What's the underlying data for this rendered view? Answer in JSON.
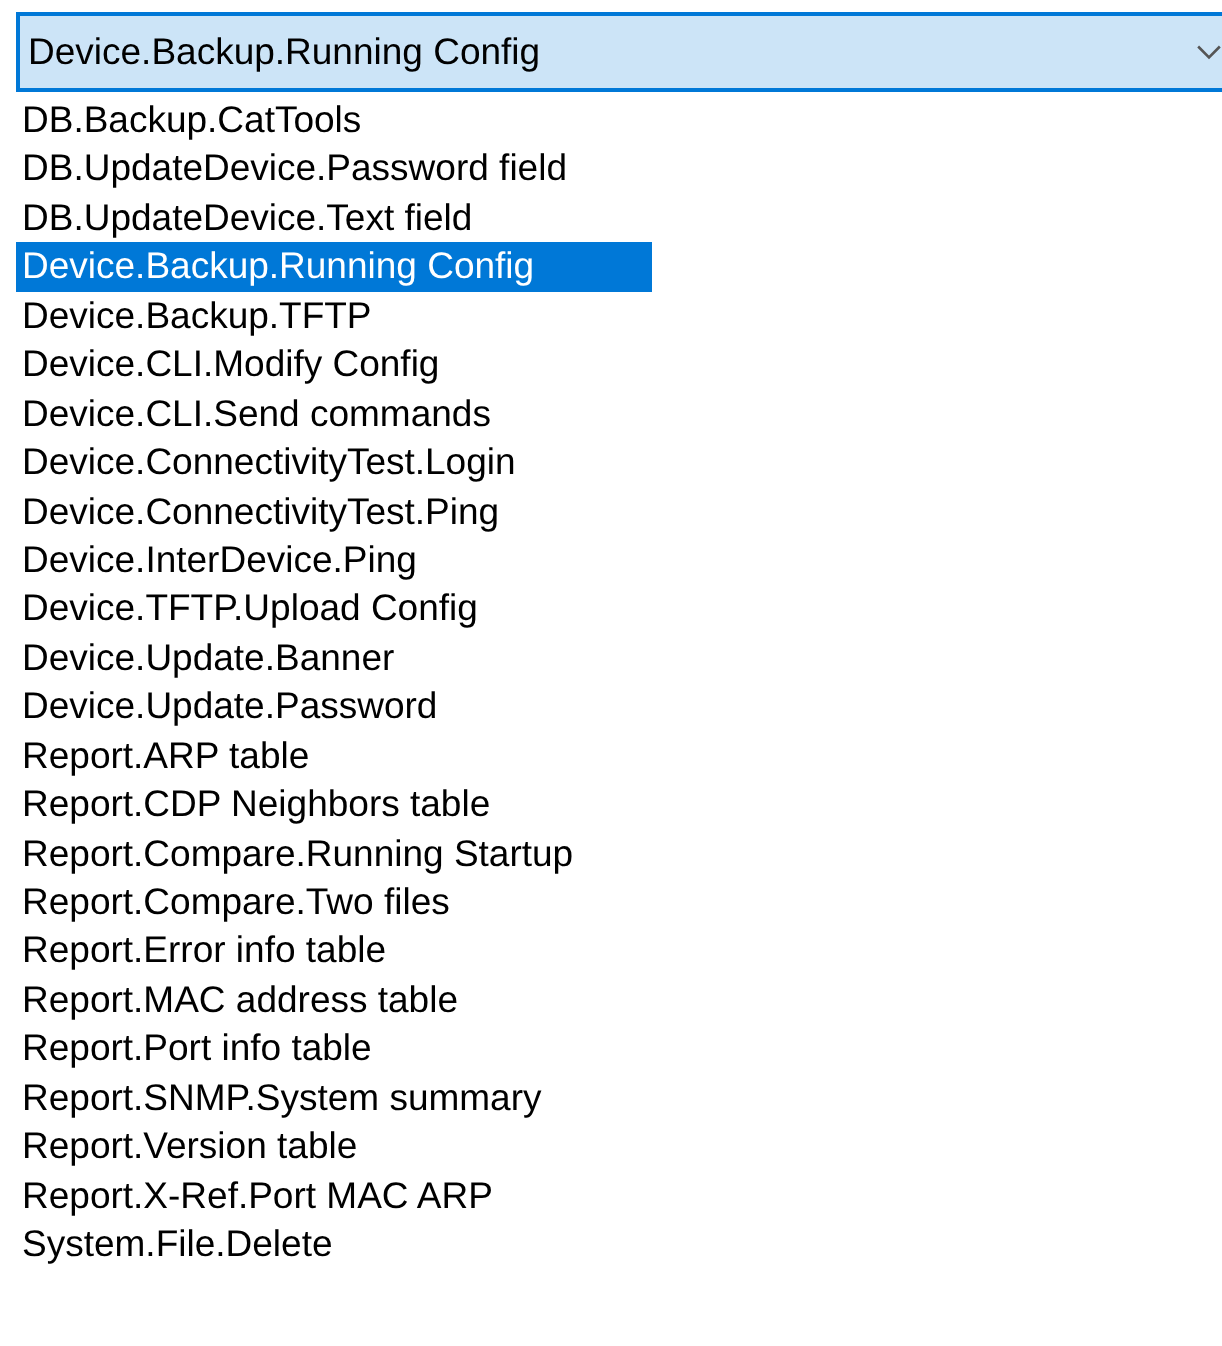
{
  "combo": {
    "value": "Device.Backup.Running Config",
    "expanded": true
  },
  "items": [
    {
      "label": "DB.Backup.CatTools",
      "selected": false
    },
    {
      "label": "DB.UpdateDevice.Password field",
      "selected": false
    },
    {
      "label": "DB.UpdateDevice.Text field",
      "selected": false
    },
    {
      "label": "Device.Backup.Running Config",
      "selected": true
    },
    {
      "label": "Device.Backup.TFTP",
      "selected": false
    },
    {
      "label": "Device.CLI.Modify Config",
      "selected": false
    },
    {
      "label": "Device.CLI.Send commands",
      "selected": false
    },
    {
      "label": "Device.ConnectivityTest.Login",
      "selected": false
    },
    {
      "label": "Device.ConnectivityTest.Ping",
      "selected": false
    },
    {
      "label": "Device.InterDevice.Ping",
      "selected": false
    },
    {
      "label": "Device.TFTP.Upload Config",
      "selected": false
    },
    {
      "label": "Device.Update.Banner",
      "selected": false
    },
    {
      "label": "Device.Update.Password",
      "selected": false
    },
    {
      "label": "Report.ARP table",
      "selected": false
    },
    {
      "label": "Report.CDP Neighbors table",
      "selected": false
    },
    {
      "label": "Report.Compare.Running Startup",
      "selected": false
    },
    {
      "label": "Report.Compare.Two files",
      "selected": false
    },
    {
      "label": "Report.Error info table",
      "selected": false
    },
    {
      "label": "Report.MAC address table",
      "selected": false
    },
    {
      "label": "Report.Port info table",
      "selected": false
    },
    {
      "label": "Report.SNMP.System summary",
      "selected": false
    },
    {
      "label": "Report.Version table",
      "selected": false
    },
    {
      "label": "Report.X-Ref.Port MAC ARP",
      "selected": false
    },
    {
      "label": "System.File.Delete",
      "selected": false
    }
  ]
}
